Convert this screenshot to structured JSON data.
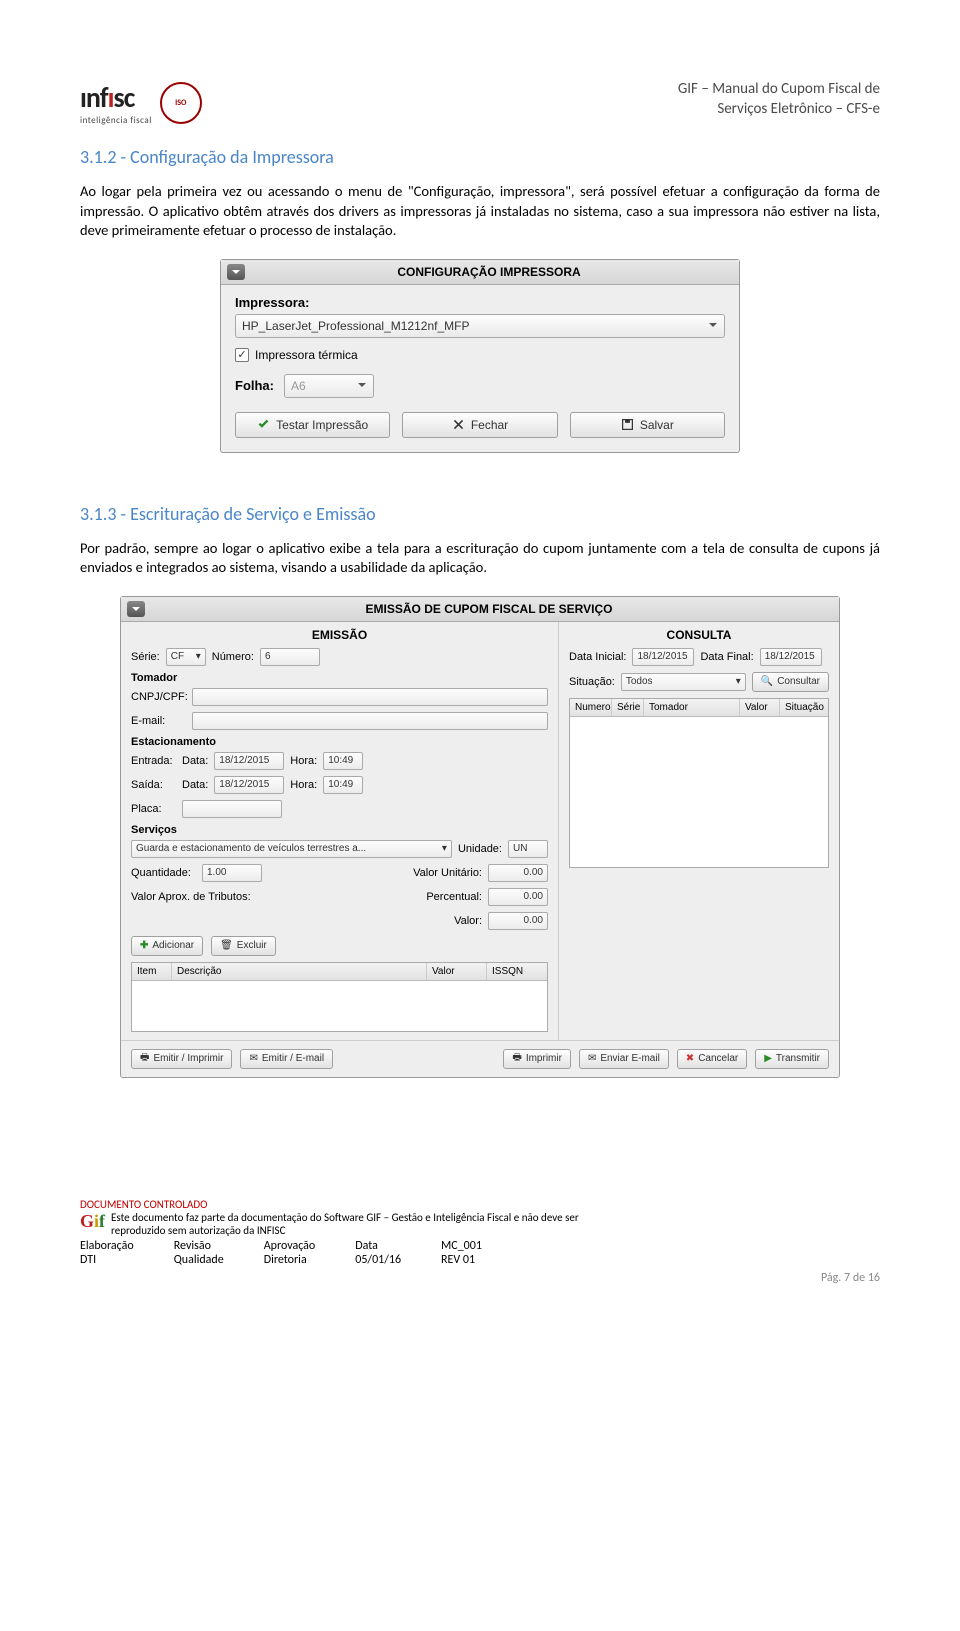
{
  "header": {
    "logo_text": "ınfısc",
    "logo_sub": "inteligência fiscal",
    "iso": "ISO",
    "doc_title_line1": "GIF – Manual do Cupom Fiscal de",
    "doc_title_line2": "Serviços Eletrônico – CFS-e"
  },
  "section1": {
    "heading": "3.1.2 - Configuração da Impressora",
    "body": "Ao logar pela primeira vez ou acessando o menu de \"Configuração, impressora\", será possível efetuar a configuração da forma de impressão. O aplicativo obtêm através dos drivers as impressoras já instaladas no sistema, caso a sua impressora não estiver na lista, deve primeiramente efetuar o processo de instalação."
  },
  "dialog1": {
    "title": "CONFIGURAÇÃO IMPRESSORA",
    "label_impressora": "Impressora:",
    "combo_value": "HP_LaserJet_Professional_M1212nf_MFP",
    "check_label": "Impressora térmica",
    "label_folha": "Folha:",
    "folha_value": "A6",
    "btn_test": "Testar Impressão",
    "btn_close": "Fechar",
    "btn_save": "Salvar"
  },
  "section2": {
    "heading": "3.1.3 - Escrituração de Serviço e Emissão",
    "body": "Por padrão, sempre ao logar o aplicativo exibe a tela para a escrituração do cupom juntamente com a tela de consulta de cupons já enviados e integrados ao sistema, visando a usabilidade da aplicação."
  },
  "dialog2": {
    "title": "EMISSÃO DE CUPOM FISCAL DE SERVIÇO",
    "left_title": "EMISSÃO",
    "right_title": "CONSULTA",
    "labels": {
      "serie": "Série:",
      "serie_val": "CF",
      "numero": "Número:",
      "numero_val": "6",
      "tomador": "Tomador",
      "cnpj": "CNPJ/CPF:",
      "email": "E-mail:",
      "estac": "Estacionamento",
      "entrada": "Entrada:",
      "saida": "Saída:",
      "data": "Data:",
      "data_val": "18/12/2015",
      "hora": "Hora:",
      "hora_val": "10:49",
      "placa": "Placa:",
      "servicos": "Serviços",
      "servico_val": "Guarda e estacionamento de veículos terrestres a...",
      "unidade": "Unidade:",
      "unidade_val": "UN",
      "quantidade": "Quantidade:",
      "quantidade_val": "1.00",
      "valor_unit": "Valor Unitário:",
      "valor_unit_val": "0.00",
      "valor_aprox": "Valor Aprox. de Tributos:",
      "percentual": "Percentual:",
      "percentual_val": "0.00",
      "valor": "Valor:",
      "valor_val": "0.00",
      "adicionar": "Adicionar",
      "excluir": "Excluir",
      "data_inicial": "Data Inicial:",
      "data_final": "Data Final:",
      "situacao": "Situação:",
      "situacao_val": "Todos",
      "consultar": "Consultar"
    },
    "tbl_left": [
      "Item",
      "Descrição",
      "Valor",
      "ISSQN"
    ],
    "tbl_right": [
      "Numero",
      "Série",
      "Tomador",
      "Valor",
      "Situação"
    ],
    "buttons": {
      "emitir_imp": "Emitir / Imprimir",
      "emitir_email": "Emitir / E-mail",
      "imprimir": "Imprimir",
      "enviar_email": "Enviar E-mail",
      "cancelar": "Cancelar",
      "transmitir": "Transmitir"
    }
  },
  "footer": {
    "controlado": "DOCUMENTO CONTROLADO",
    "line1": "Este documento faz parte da documentação do Software GIF – Gestão e Inteligência Fiscal e não deve ser",
    "line2": "reproduzido sem autorização da INFISC",
    "elab_l": "Elaboração",
    "elab_v": "DTI",
    "rev_l": "Revisão",
    "rev_v": "Qualidade",
    "aprov_l": "Aprovação",
    "aprov_v": "Diretoria",
    "data_l": "Data",
    "data_v": "05/01/16",
    "mc": "MC_001",
    "rev": "REV 01",
    "page": "Pág. 7 de 16"
  }
}
